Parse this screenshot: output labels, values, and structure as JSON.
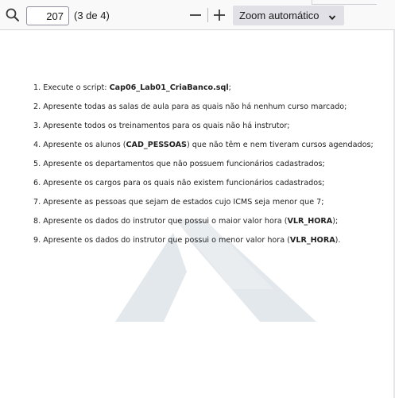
{
  "toolbar": {
    "page_number": "207",
    "page_count": "(3 de 4)",
    "zoom_selected": "Zoom automático",
    "icons": {
      "search": "search-icon",
      "zoom_out": "minus-icon",
      "zoom_in": "plus-icon",
      "dropdown": "chevron-down-icon"
    }
  },
  "document": {
    "watermark": "watermark-logo",
    "tasks": [
      {
        "num": "1.",
        "pre": "Execute o script: ",
        "bold": "Cap06_Lab01_CriaBanco.sql",
        "post": ";"
      },
      {
        "num": "2.",
        "pre": "Apresente todas as salas de aula para as quais não há nenhum curso marcado;",
        "bold": "",
        "post": ""
      },
      {
        "num": "3.",
        "pre": "Apresente todos os treinamentos para os quais não há instrutor;",
        "bold": "",
        "post": ""
      },
      {
        "num": "4.",
        "pre": "Apresente os alunos (",
        "bold": "CAD_PESSOAS",
        "post": ") que não têm e nem tiveram cursos agendados;"
      },
      {
        "num": "5.",
        "pre": "Apresente os departamentos que não possuem funcionários cadastrados;",
        "bold": "",
        "post": ""
      },
      {
        "num": "6.",
        "pre": "Apresente os cargos para os quais não existem funcionários cadastrados;",
        "bold": "",
        "post": ""
      },
      {
        "num": "7.",
        "pre": "Apresente as pessoas que sejam de estados cujo ICMS seja menor que 7;",
        "bold": "",
        "post": ""
      },
      {
        "num": "8.",
        "pre": "Apresente os dados do instrutor que possui o maior valor hora (",
        "bold": "VLR_HORA",
        "post": ");"
      },
      {
        "num": "9.",
        "pre": "Apresente os dados do instrutor que possui o menor valor hora (",
        "bold": "VLR_HORA",
        "post": ")."
      }
    ]
  }
}
